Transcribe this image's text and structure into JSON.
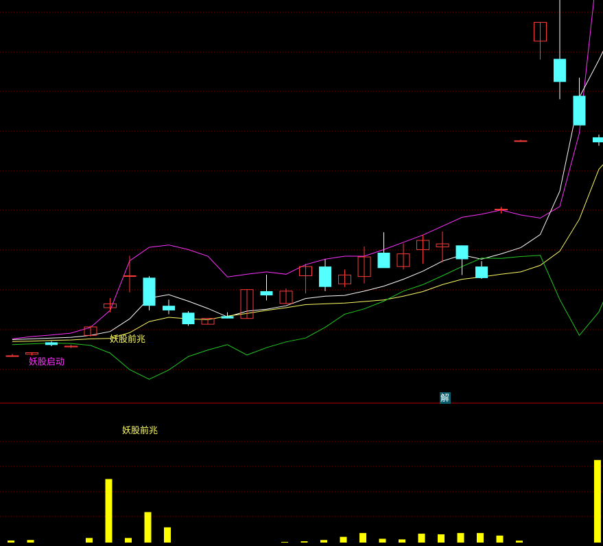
{
  "colors": {
    "background": "#000000",
    "grid": "#7a0000",
    "divider": "#b00000",
    "up_candle": "#ff3b3b",
    "down_candle": "#54ffff",
    "upper_band": "#ff33ff",
    "middle_line": "#ffffff",
    "ma_line": "#ffff66",
    "lower_band": "#22cc22",
    "volume": "#ffff00",
    "annotation_yellow": "#ffff66",
    "annotation_magenta": "#ff33ff",
    "marker_bg": "#0b5b6b",
    "marker_text": "#ffffff"
  },
  "annotations": {
    "signal_top": "妖股前兆",
    "signal_bottom": "妖股前兆",
    "signal_left_magenta": "妖股启动",
    "marker": "解"
  },
  "chart_data": [
    {
      "type": "candlestick",
      "panel": "price",
      "ylim": [
        0,
        100
      ],
      "grid": true,
      "candles": [
        {
          "o": 7.5,
          "h": 8.0,
          "l": 7.2,
          "c": 7.5
        },
        {
          "o": 7.9,
          "h": 8.4,
          "l": 7.6,
          "c": 8.3
        },
        {
          "o": 11.0,
          "h": 11.3,
          "l": 10.0,
          "c": 10.3
        },
        {
          "o": 9.8,
          "h": 10.4,
          "l": 9.5,
          "c": 10.0
        },
        {
          "o": 12.8,
          "h": 15.3,
          "l": 12.5,
          "c": 15.0
        },
        {
          "o": 20.0,
          "h": 22.5,
          "l": 18.8,
          "c": 21.0
        },
        {
          "o": 28.3,
          "h": 33.5,
          "l": 24.0,
          "c": 28.3
        },
        {
          "o": 27.8,
          "h": 28.2,
          "l": 19.3,
          "c": 20.5
        },
        {
          "o": 20.5,
          "h": 22.1,
          "l": 18.3,
          "c": 19.3
        },
        {
          "o": 18.7,
          "h": 19.1,
          "l": 15.3,
          "c": 15.7
        },
        {
          "o": 15.7,
          "h": 17.2,
          "l": 15.7,
          "c": 17.2
        },
        {
          "o": 17.8,
          "h": 18.8,
          "l": 17.2,
          "c": 17.2
        },
        {
          "o": 17.2,
          "h": 24.7,
          "l": 17.2,
          "c": 24.7
        },
        {
          "o": 24.3,
          "h": 28.6,
          "l": 21.9,
          "c": 23.2
        },
        {
          "o": 21.1,
          "h": 25.0,
          "l": 21.1,
          "c": 24.3
        },
        {
          "o": 28.3,
          "h": 31.4,
          "l": 23.7,
          "c": 30.7
        },
        {
          "o": 30.7,
          "h": 32.6,
          "l": 24.3,
          "c": 25.4
        },
        {
          "o": 26.2,
          "h": 29.9,
          "l": 25.4,
          "c": 28.5
        },
        {
          "o": 28.1,
          "h": 35.9,
          "l": 26.3,
          "c": 33.2
        },
        {
          "o": 34.3,
          "h": 39.6,
          "l": 31.8,
          "c": 30.3
        },
        {
          "o": 30.7,
          "h": 36.7,
          "l": 29.9,
          "c": 34.0
        },
        {
          "o": 35.1,
          "h": 39.0,
          "l": 31.4,
          "c": 37.5
        },
        {
          "o": 35.8,
          "h": 39.8,
          "l": 31.8,
          "c": 36.6
        },
        {
          "o": 36.2,
          "h": 36.2,
          "l": 28.5,
          "c": 32.6
        },
        {
          "o": 30.7,
          "h": 32.1,
          "l": 27.5,
          "c": 27.7
        },
        {
          "o": 45.6,
          "h": 46.2,
          "l": 44.5,
          "c": 45.6
        },
        {
          "o": 63.4,
          "h": 63.7,
          "l": 63.1,
          "c": 63.4
        },
        {
          "o": 89.3,
          "h": 94.2,
          "l": 84.5,
          "c": 94.2
        },
        {
          "o": 84.7,
          "h": 101,
          "l": 74.2,
          "c": 78.7
        },
        {
          "o": 75.1,
          "h": 79.8,
          "l": 68.1,
          "c": 67.4
        },
        {
          "o": 64.3,
          "h": 65.0,
          "l": 62.1,
          "c": 63.0
        }
      ],
      "series": [
        {
          "values": [
            11.9,
            12.5,
            12.9,
            13.4,
            14.9,
            19.3,
            32.2,
            35.7,
            36.3,
            35.1,
            33.4,
            28.0,
            28.7,
            29.3,
            28.7,
            31.2,
            32.6,
            33.4,
            33.4,
            35.1,
            37.0,
            38.9,
            41.2,
            43.5,
            44.3,
            45.4,
            44.1,
            43.3,
            46.3,
            65.4,
            112.0,
            128.0
          ]
        },
        {
          "values": [
            11.7,
            11.9,
            12.1,
            12.3,
            12.8,
            13.8,
            17.1,
            22.5,
            23.4,
            21.7,
            19.8,
            17.6,
            19.1,
            19.6,
            20.5,
            22.4,
            23.0,
            23.2,
            24.3,
            25.6,
            27.4,
            29.5,
            32.1,
            33.7,
            32.6,
            34.0,
            35.6,
            39.0,
            50.3,
            74.7,
            84.4,
            94.9
          ]
        },
        {
          "values": [
            11.2,
            11.3,
            11.5,
            11.6,
            11.9,
            12.0,
            13.5,
            16.4,
            17.5,
            17.1,
            16.9,
            17.8,
            18.5,
            19.3,
            20.0,
            20.8,
            21.0,
            21.2,
            21.6,
            22.0,
            23.0,
            24.2,
            26.0,
            27.4,
            28.0,
            28.7,
            29.3,
            31.0,
            34.7,
            43.0,
            56.0,
            61.5
          ]
        },
        {
          "values": [
            10.4,
            10.6,
            10.8,
            10.7,
            10.2,
            8.2,
            3.9,
            1.4,
            3.8,
            7.3,
            9.0,
            10.4,
            7.7,
            9.6,
            11.1,
            12.1,
            14.9,
            18.3,
            19.7,
            21.7,
            24.3,
            26.0,
            28.3,
            30.7,
            32.9,
            32.8,
            33.3,
            33.6,
            22.1,
            12.8,
            18.9,
            30.7
          ]
        }
      ]
    },
    {
      "type": "bar",
      "panel": "volume",
      "grid": true,
      "ylim": [
        0,
        100
      ],
      "values": [
        1.6,
        2.0,
        0,
        0,
        3.6,
        50,
        3.6,
        24.0,
        12.0,
        0,
        0,
        0,
        0,
        0,
        0.5,
        1.0,
        2.0,
        4.5,
        7.5,
        3.0,
        2.5,
        7.0,
        6.5,
        7.5,
        7.5,
        5.5,
        1.5,
        0,
        0,
        0,
        65,
        56,
        0
      ]
    }
  ]
}
